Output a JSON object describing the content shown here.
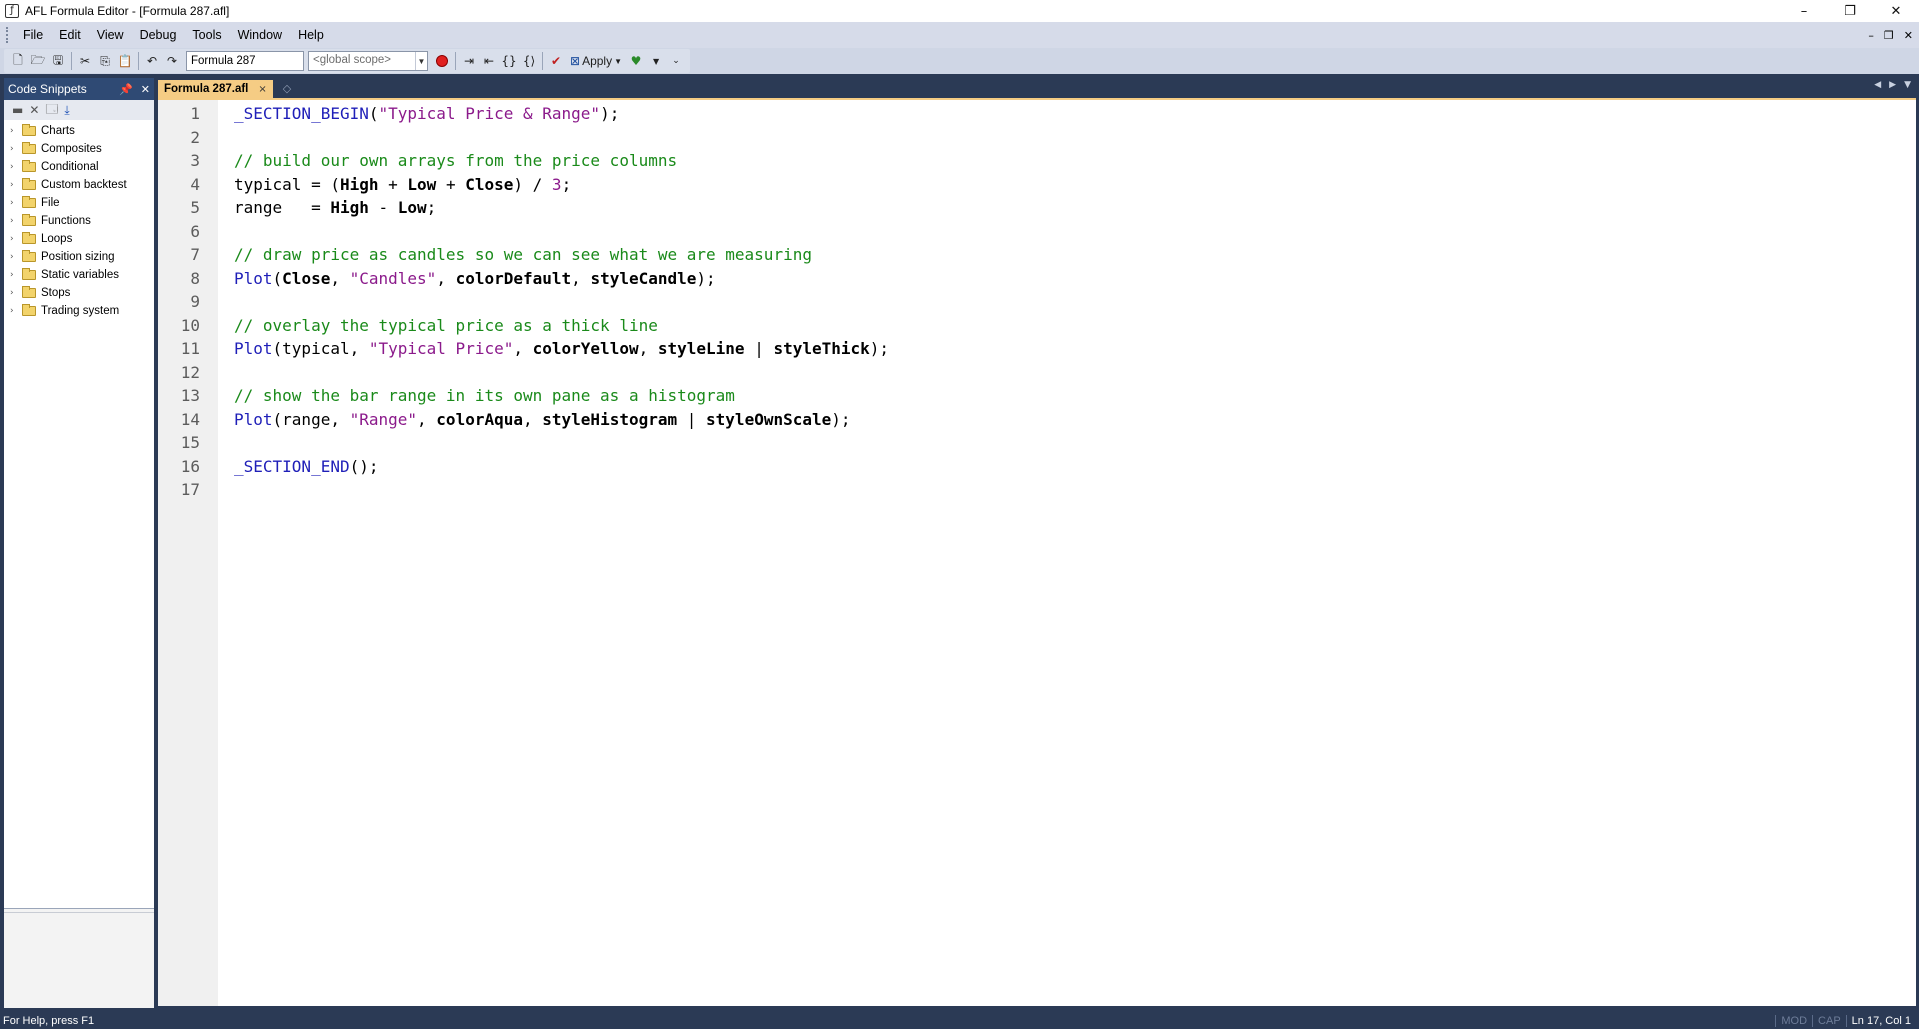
{
  "window": {
    "title": "AFL Formula Editor - [Formula 287.afl]",
    "app_icon": "afl-app-icon",
    "controls": [
      "minimize",
      "restore",
      "close"
    ]
  },
  "menu": {
    "items": [
      "File",
      "Edit",
      "View",
      "Debug",
      "Tools",
      "Window",
      "Help"
    ]
  },
  "toolbar": {
    "formula_name": "Formula 287",
    "scope_placeholder": "<global scope>",
    "apply_label": "Apply"
  },
  "snippets": {
    "title": "Code Snippets",
    "items": [
      "Charts",
      "Composites",
      "Conditional",
      "Custom backtest",
      "File",
      "Functions",
      "Loops",
      "Position sizing",
      "Static variables",
      "Stops",
      "Trading system"
    ]
  },
  "editor": {
    "tab_label": "Formula 287.afl",
    "line_numbers": [
      "1",
      "2",
      "3",
      "4",
      "5",
      "6",
      "7",
      "8",
      "9",
      "10",
      "11",
      "12",
      "13",
      "14",
      "15",
      "16",
      "17"
    ],
    "lines": [
      [
        {
          "t": "_SECTION_BEGIN",
          "c": "kw"
        },
        {
          "t": "(",
          "c": "plain"
        },
        {
          "t": "\"Typical Price & Range\"",
          "c": "str"
        },
        {
          "t": ");",
          "c": "plain"
        }
      ],
      [],
      [
        {
          "t": "// build our own arrays from the price columns",
          "c": "cm"
        }
      ],
      [
        {
          "t": "typical = (",
          "c": "plain"
        },
        {
          "t": "High",
          "c": "bold"
        },
        {
          "t": " + ",
          "c": "plain"
        },
        {
          "t": "Low",
          "c": "bold"
        },
        {
          "t": " + ",
          "c": "plain"
        },
        {
          "t": "Close",
          "c": "bold"
        },
        {
          "t": ") / ",
          "c": "plain"
        },
        {
          "t": "3",
          "c": "num"
        },
        {
          "t": ";",
          "c": "plain"
        }
      ],
      [
        {
          "t": "range   = ",
          "c": "plain"
        },
        {
          "t": "High",
          "c": "bold"
        },
        {
          "t": " - ",
          "c": "plain"
        },
        {
          "t": "Low",
          "c": "bold"
        },
        {
          "t": ";",
          "c": "plain"
        }
      ],
      [],
      [
        {
          "t": "// draw price as candles so we can see what we are measuring",
          "c": "cm"
        }
      ],
      [
        {
          "t": "Plot",
          "c": "kw"
        },
        {
          "t": "(",
          "c": "plain"
        },
        {
          "t": "Close",
          "c": "bold"
        },
        {
          "t": ", ",
          "c": "plain"
        },
        {
          "t": "\"Candles\"",
          "c": "str"
        },
        {
          "t": ", ",
          "c": "plain"
        },
        {
          "t": "colorDefault",
          "c": "bold"
        },
        {
          "t": ", ",
          "c": "plain"
        },
        {
          "t": "styleCandle",
          "c": "bold"
        },
        {
          "t": ");",
          "c": "plain"
        }
      ],
      [],
      [
        {
          "t": "// overlay the typical price as a thick line",
          "c": "cm"
        }
      ],
      [
        {
          "t": "Plot",
          "c": "kw"
        },
        {
          "t": "(typical, ",
          "c": "plain"
        },
        {
          "t": "\"Typical Price\"",
          "c": "str"
        },
        {
          "t": ", ",
          "c": "plain"
        },
        {
          "t": "colorYellow",
          "c": "bold"
        },
        {
          "t": ", ",
          "c": "plain"
        },
        {
          "t": "styleLine",
          "c": "bold"
        },
        {
          "t": " | ",
          "c": "plain"
        },
        {
          "t": "styleThick",
          "c": "bold"
        },
        {
          "t": ");",
          "c": "plain"
        }
      ],
      [],
      [
        {
          "t": "// show the bar range in its own pane as a histogram",
          "c": "cm"
        }
      ],
      [
        {
          "t": "Plot",
          "c": "kw"
        },
        {
          "t": "(range, ",
          "c": "plain"
        },
        {
          "t": "\"Range\"",
          "c": "str"
        },
        {
          "t": ", ",
          "c": "plain"
        },
        {
          "t": "colorAqua",
          "c": "bold"
        },
        {
          "t": ", ",
          "c": "plain"
        },
        {
          "t": "styleHistogram",
          "c": "bold"
        },
        {
          "t": " | ",
          "c": "plain"
        },
        {
          "t": "styleOwnScale",
          "c": "bold"
        },
        {
          "t": ");",
          "c": "plain"
        }
      ],
      [],
      [
        {
          "t": "_SECTION_END",
          "c": "kw"
        },
        {
          "t": "();",
          "c": "plain"
        }
      ],
      []
    ]
  },
  "status": {
    "help": "For Help, press F1",
    "mod": "MOD",
    "cap": "CAP",
    "position": "Ln 17, Col 1"
  },
  "colors": {
    "accent_tab": "#f5cc84",
    "frame": "#2b3a55",
    "keyword": "#1f1fb8",
    "string": "#8b1a8b",
    "comment": "#1a8a1a"
  }
}
